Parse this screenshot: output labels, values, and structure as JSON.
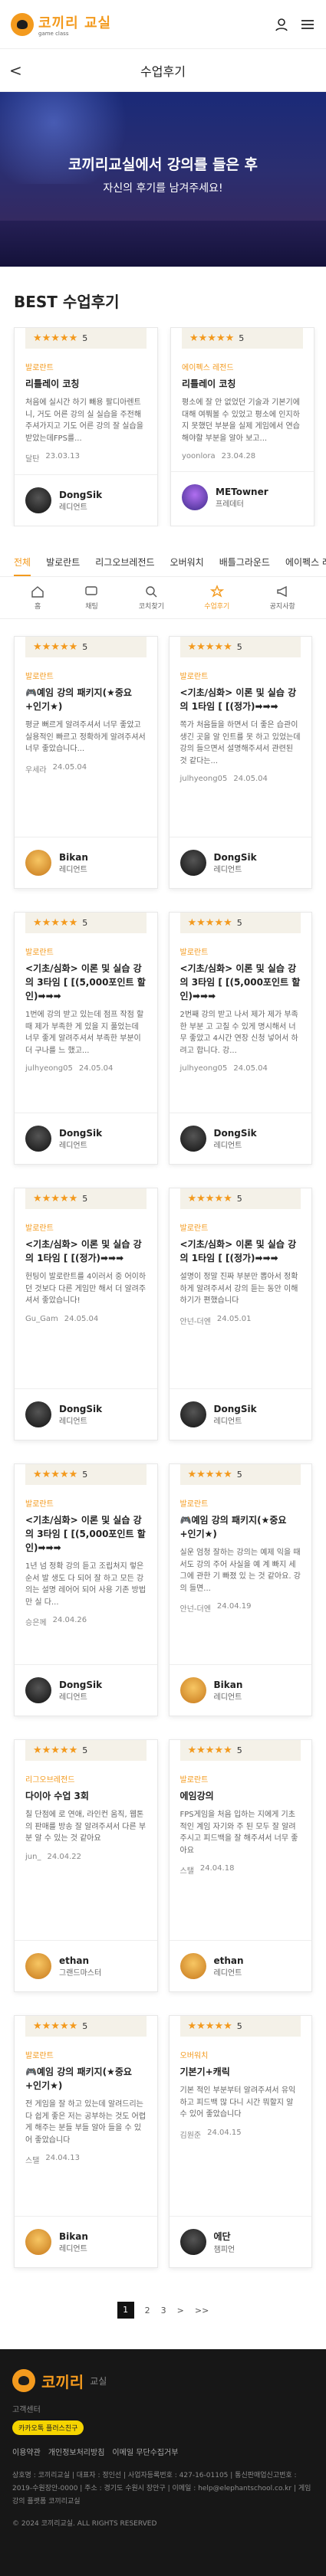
{
  "header": {
    "logo_main": "코끼리 교실",
    "logo_sub": "game class",
    "user_icon": "user-icon",
    "menu_icon": "hamburger-icon"
  },
  "subheader": {
    "title": "수업후기",
    "back_label": "<"
  },
  "hero": {
    "title": "코끼리교실에서 강의를 들은 후",
    "subtitle": "자신의 후기를 남겨주세요!"
  },
  "best": {
    "title": "BEST 수업후기",
    "cards": [
      {
        "stars": "★★★★★",
        "score": "5",
        "category": "발로란트",
        "title": "리틀레이 코칭",
        "body": "처음에 실시간 하기 빼용 팔디아렌트니, 거도 어른 강의 실 실습을 주전해주셔가지고 기도 어른 강의 잘 실습을 받았는데FPS를...",
        "user_short": "달탄",
        "date": "23.03.13",
        "author": "DongSik",
        "role": "레디언트",
        "avatar": "dark"
      },
      {
        "stars": "★★★★★",
        "score": "5",
        "category": "에이펙스 레전드",
        "title": "리틀레이 코칭",
        "body": "평소에 잘 안 없었던 기술과 기본기에 대해 여쭤볼 수 있었고 평소에 인지하지 못했던 부분을 실제 게임에서 연습해야할 부분을 알아 보고...",
        "user_short": "yoonlora",
        "date": "23.04.28",
        "author": "METowner",
        "role": "프레데터",
        "avatar": "purple"
      }
    ]
  },
  "tabs": [
    {
      "label": "전체",
      "active": true
    },
    {
      "label": "발로란트"
    },
    {
      "label": "리그오브레전드"
    },
    {
      "label": "오버워치"
    },
    {
      "label": "배틀그라운드"
    },
    {
      "label": "에이펙스 레전드"
    }
  ],
  "icons": [
    {
      "label": "홈",
      "icon": "home-icon"
    },
    {
      "label": "채팅",
      "icon": "chat-icon"
    },
    {
      "label": "코치찾기",
      "icon": "search-icon"
    },
    {
      "label": "수업후기",
      "icon": "review-icon",
      "active": true
    },
    {
      "label": "공지사항",
      "icon": "megaphone-icon"
    }
  ],
  "reviews": [
    {
      "stars": "★★★★★",
      "score": "5",
      "category": "발로란트",
      "title": "🎮예임 강의 패키지(★중요+인기★)",
      "body": "평균 뻐르게 알려주셔서 너무 좋았고 실용적인 빠르고 정확하게 알려주셔서 너무 좋았습니다...",
      "user_short": "우세라",
      "date": "24.05.04",
      "author": "Bikan",
      "role": "레디언트",
      "avatar": ""
    },
    {
      "stars": "★★★★★",
      "score": "5",
      "category": "발로란트",
      "title": "<기초/심화> 이론 및 실습 강의 1타임 [ [(정가)➡➡➡",
      "body": "쪽가 처음들을 하면서 더 좋은 습관이 생긴 곳을 알 인트를 못 하고 있었는데 강의 들으면서 설명해주셔서 관련된 것 같다는...",
      "user_short": "julhyeong05",
      "date": "24.05.04",
      "author": "DongSik",
      "role": "레디언트",
      "avatar": "dark"
    },
    {
      "stars": "★★★★★",
      "score": "5",
      "category": "발로란트",
      "title": "<기초/심화> 이론 및 실습 강의 3타임 [ [(5,000포인트 할인)➡➡➡",
      "body": "1번에 강의 받고 있는데 점프 작점 할 때 제가 부족한 게 있을 지 풀었는데 너무 좋게 알려주셔서 부족한 부분이 더 구나를 느 했고...",
      "user_short": "julhyeong05",
      "date": "24.05.04",
      "author": "DongSik",
      "role": "레디언트",
      "avatar": "dark"
    },
    {
      "stars": "★★★★★",
      "score": "5",
      "category": "발로란트",
      "title": "<기초/심화> 이론 및 실습 강의 3타임 [ [(5,000포인트 할인)➡➡➡",
      "body": "2번째 강의 받고 나서 제가 제가 부족한 부분 고 고칠 수 있게 명시해서 너무 좋았고 4시간 연장 신청 넣어서 하려고 합니다. 강...",
      "user_short": "julhyeong05",
      "date": "24.05.04",
      "author": "DongSik",
      "role": "레디언트",
      "avatar": "dark"
    },
    {
      "stars": "★★★★★",
      "score": "5",
      "category": "발로란트",
      "title": "<기초/심화> 이론 및 실습 강의 1타임 [ [(정가)➡➡➡",
      "body": "헌팅이 발로란트를 4이러서 중 어이하던 것보다 다른 게임만 해서 더 알려주셔서 좋았습니다!",
      "user_short": "Gu_Gam",
      "date": "24.05.04",
      "author": "DongSik",
      "role": "레디언트",
      "avatar": "dark"
    },
    {
      "stars": "★★★★★",
      "score": "5",
      "category": "발로란트",
      "title": "<기초/심화> 이론 및 실습 강의 1타임 [ [(정가)➡➡➡",
      "body": "설명이 정말 진짜 부분만 뽑아서 정확하게 알려주셔서 강의 듣는 동안 이해하기가 편했습니다",
      "user_short": "안넌-더엔",
      "date": "24.05.01",
      "author": "DongSik",
      "role": "레디언트",
      "avatar": "dark"
    },
    {
      "stars": "★★★★★",
      "score": "5",
      "category": "발로란트",
      "title": "<기초/심화> 이론 및 실습 강의 3타임 [ [(5,000포인트 할인)➡➡➡",
      "body": "1년 넘 정확 강의 듣고 조립처지 렇은 순서 발 생도 다 되어 잘 하고 모든 강의는 설명 레어어 되어 사용 기존 방법 만 실 다...",
      "user_short": "승은께",
      "date": "24.04.26",
      "author": "DongSik",
      "role": "레디언트",
      "avatar": "dark"
    },
    {
      "stars": "★★★★★",
      "score": "5",
      "category": "발로란트",
      "title": "🎮예임 강의 패키지(★중요+인기★)",
      "body": "실운 엄청 잘하는 강의는 예제 익을 때 서도 강의 주어 사실을 예 계 빠지 세 그에 관한 기 빠졌 있 는 것 같아요. 강의 들면...",
      "user_short": "안넌-더엔",
      "date": "24.04.19",
      "author": "Bikan",
      "role": "레디언트",
      "avatar": ""
    },
    {
      "stars": "★★★★★",
      "score": "5",
      "category": "리그오브레전드",
      "title": "다이아 수업 3회",
      "body": "칠 단점에 로 연애, 라인컨 움직, 웹톤 의 판매를 방송 잘 알려주셔서 다른 부분 알 수 있는 것 같아요",
      "user_short": "jun_",
      "date": "24.04.22",
      "author": "ethan",
      "role": "그랜드마스터",
      "avatar": ""
    },
    {
      "stars": "★★★★★",
      "score": "5",
      "category": "발로란트",
      "title": "에임강의",
      "body": "FPS게임을 처음 입하는 지에게 기초적인 계임 자기와 주 된 모두 잘 알려주시고 피드백을 잘 해주셔서 너무 좋아요",
      "user_short": "스탤",
      "date": "24.04.18",
      "author": "ethan",
      "role": "레디언트",
      "avatar": ""
    },
    {
      "stars": "★★★★★",
      "score": "5",
      "category": "발로란트",
      "title": "🎮예임 강의 패키지(★중요+인기★)",
      "body": "전 게임을 잘 하고 있는데 알려드리는 다 쉽게 좋은 저는 공부하는 것도 어렵게 해주는 분들 부들 알아 들을 수 있어 좋았습니다",
      "user_short": "스탤",
      "date": "24.04.13",
      "author": "Bikan",
      "role": "레디언트",
      "avatar": ""
    },
    {
      "stars": "★★★★★",
      "score": "5",
      "category": "오버워치",
      "title": "기본기+캐릭",
      "body": "기본 적인 부분부터 알려주셔서 유익하고 피드백 많 다니 시간 뭐할지 알 수 있어 좋았습니다",
      "user_short": "김원준",
      "date": "24.04.15",
      "author": "에단",
      "role": "챔피언",
      "avatar": "dark"
    }
  ],
  "pager": {
    "pages": [
      "1",
      "2",
      "3"
    ],
    "current": "1",
    "next": ">",
    "last": ">>"
  },
  "footer": {
    "logo": "코끼리",
    "logo_sub": "교실",
    "cs_label": "고객센터",
    "kakao_label": "카카오톡 플러스친구",
    "links": [
      "이용약관",
      "개인정보처리방침",
      "이메일 무단수집거부"
    ],
    "info": "상호명 : 코끼리교실 | 대표자 : 정인선 | 사업자등록번호 : 427-16-01105 | 통신판매업신고번호 : 2019-수원장안-0000 | 주소 : 경기도 수원시 장안구 | 이메일 : help@elephantschool.co.kr | 게임 강의 플랫폼 코끼리교실",
    "copy": "© 2024 코끼리교실. ALL RIGHTS RESERVED"
  },
  "colors": {
    "accent": "#f39a1e",
    "hero_top": "#1a2a78",
    "footer_bg": "#171717"
  }
}
